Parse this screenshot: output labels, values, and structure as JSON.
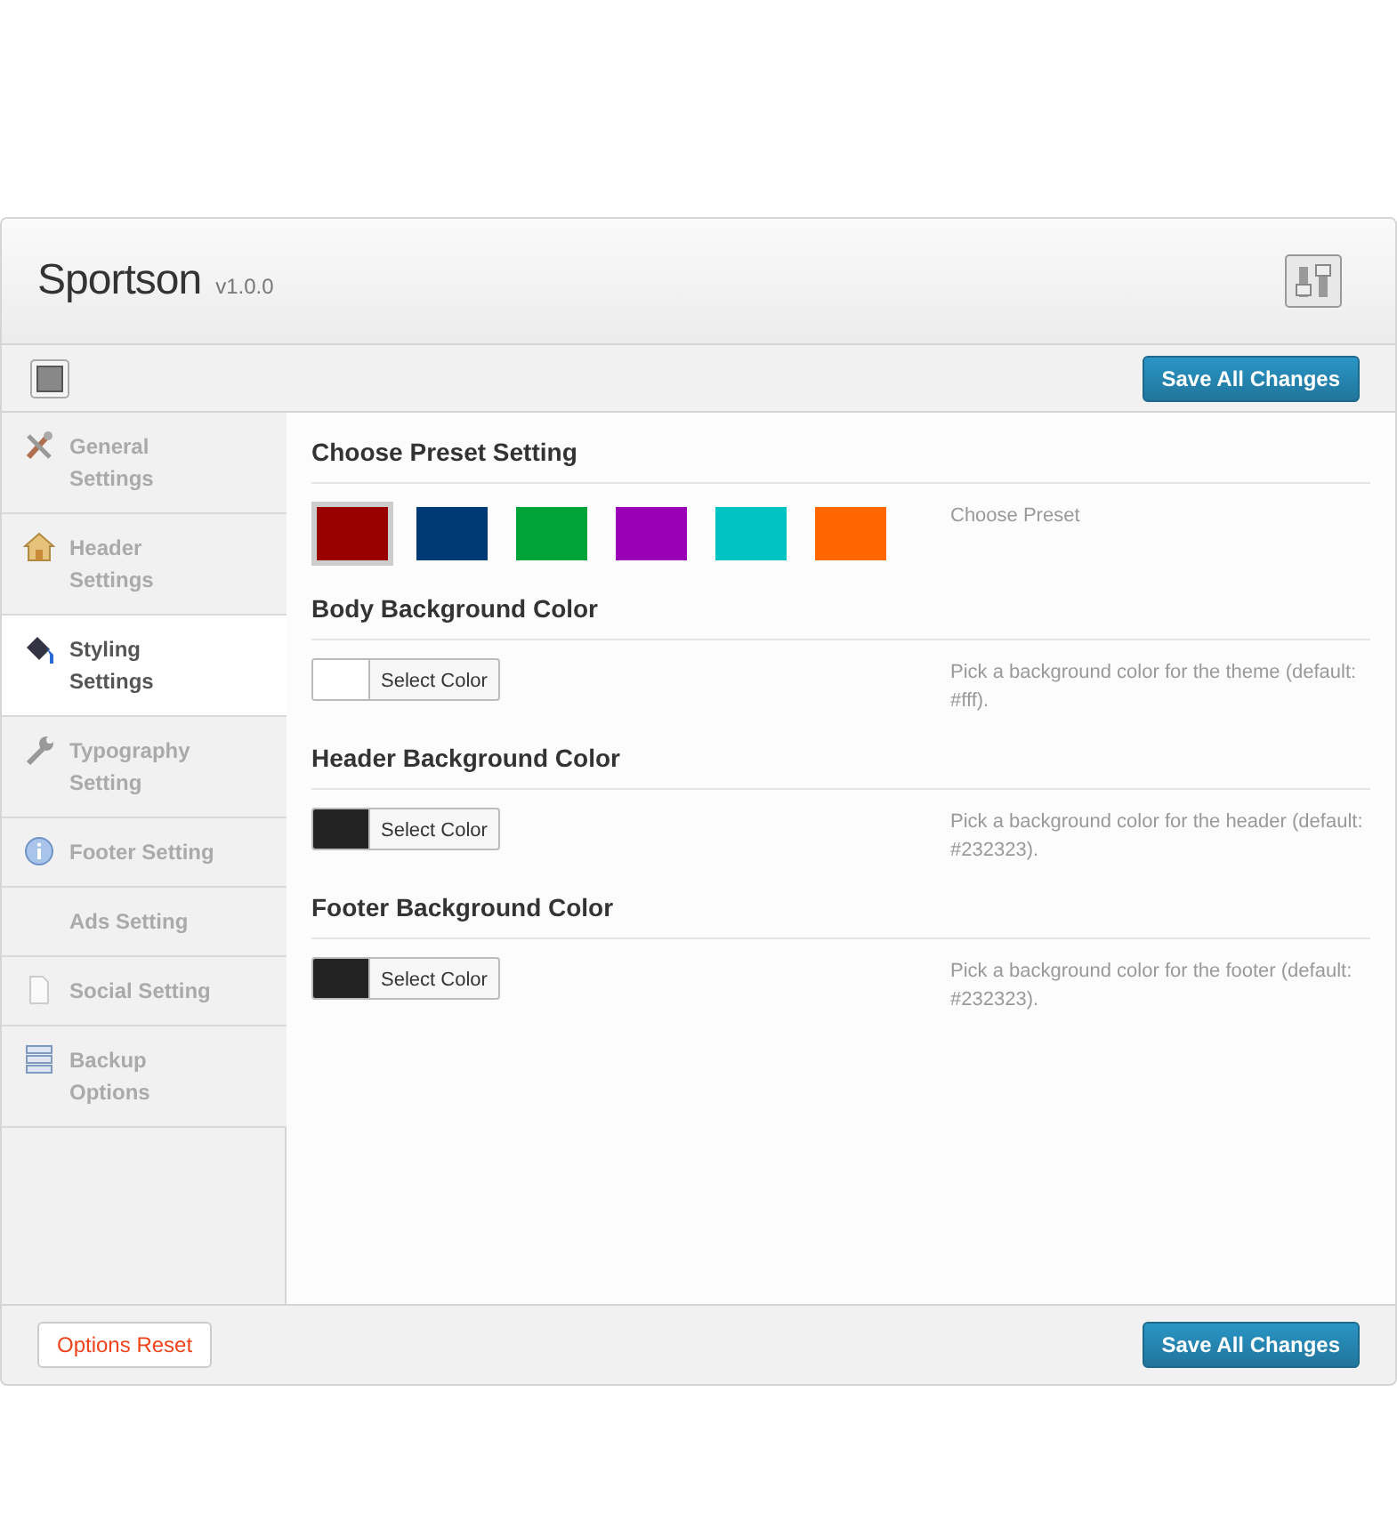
{
  "header": {
    "title": "Sportson",
    "version": "v1.0.0"
  },
  "toolbar": {
    "save_button": "Save All Changes"
  },
  "sidebar": {
    "items": [
      {
        "label": "General Settings",
        "selected": false
      },
      {
        "label": "Header Settings",
        "selected": false
      },
      {
        "label": "Styling Settings",
        "selected": true
      },
      {
        "label": "Typography Setting",
        "selected": false
      },
      {
        "label": "Footer Setting",
        "selected": false
      },
      {
        "label": "Ads Setting",
        "selected": false
      },
      {
        "label": "Social Setting",
        "selected": false
      },
      {
        "label": "Backup Options",
        "selected": false
      }
    ]
  },
  "sections": [
    {
      "kind": "preset",
      "title": "Choose Preset Setting",
      "description": "Choose Preset",
      "presets": [
        {
          "color": "#990000",
          "selected": true
        },
        {
          "color": "#003a75",
          "selected": false
        },
        {
          "color": "#00a338",
          "selected": false
        },
        {
          "color": "#9900b5",
          "selected": false
        },
        {
          "color": "#00c4c4",
          "selected": false
        },
        {
          "color": "#ff6600",
          "selected": false
        }
      ]
    },
    {
      "kind": "color",
      "title": "Body Background Color",
      "color": "#ffffff",
      "button": "Select Color",
      "description": "Pick a background color for the theme (default: #fff)."
    },
    {
      "kind": "color",
      "title": "Header Background Color",
      "color": "#232323",
      "button": "Select Color",
      "description": "Pick a background color for the header (default: #232323)."
    },
    {
      "kind": "color",
      "title": "Footer Background Color",
      "color": "#232323",
      "button": "Select Color",
      "description": "Pick a background color for the footer (default: #232323)."
    }
  ],
  "footer": {
    "reset_button": "Options Reset",
    "save_button": "Save All Changes"
  }
}
